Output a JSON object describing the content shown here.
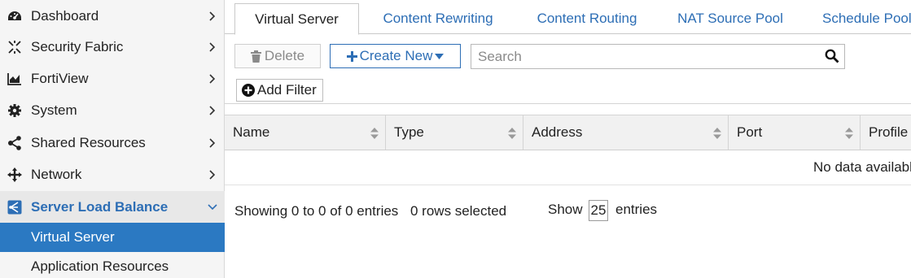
{
  "sidebar": {
    "items": [
      {
        "label": "Dashboard",
        "icon": "dashboard-icon"
      },
      {
        "label": "Security Fabric",
        "icon": "security-fabric-icon"
      },
      {
        "label": "FortiView",
        "icon": "fortiview-icon"
      },
      {
        "label": "System",
        "icon": "gear-icon"
      },
      {
        "label": "Shared Resources",
        "icon": "share-icon"
      },
      {
        "label": "Network",
        "icon": "network-icon"
      },
      {
        "label": "Server Load Balance",
        "icon": "load-balance-icon",
        "expanded": true
      }
    ],
    "sub_items": [
      {
        "label": "Virtual Server",
        "selected": true
      },
      {
        "label": "Application Resources",
        "selected": false
      }
    ]
  },
  "tabs": [
    {
      "label": "Virtual Server",
      "active": true
    },
    {
      "label": "Content Rewriting",
      "active": false
    },
    {
      "label": "Content Routing",
      "active": false
    },
    {
      "label": "NAT Source Pool",
      "active": false
    },
    {
      "label": "Schedule Pool",
      "active": false
    }
  ],
  "toolbar": {
    "delete_label": "Delete",
    "create_new_label": "Create New",
    "search_placeholder": "Search",
    "add_filter_label": "Add Filter"
  },
  "table": {
    "columns": [
      "Name",
      "Type",
      "Address",
      "Port",
      "Profile"
    ],
    "empty_message": "No data available"
  },
  "footer": {
    "showing": "Showing 0 to 0 of 0 entries",
    "rows_selected": "0 rows selected",
    "show_label": "Show",
    "page_size": "25",
    "entries_label": "entries"
  },
  "colors": {
    "accent": "#2d6eb5",
    "selected_bg": "#2b79c2",
    "sidebar_bg": "#f5f5f5"
  }
}
